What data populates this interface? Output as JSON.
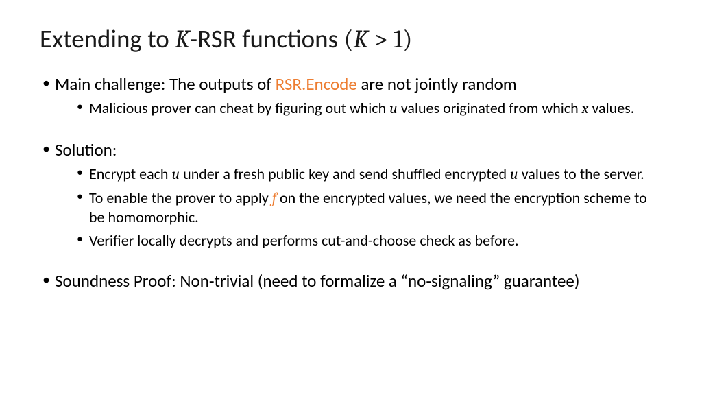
{
  "title": {
    "pre": "Extending to ",
    "k1": "K",
    "mid": "-RSR functions ",
    "paren_open": "(",
    "k2": "K",
    "gt": " > ",
    "one": "1",
    "paren_close": ")"
  },
  "bullets": {
    "b1": {
      "pre": "Main challenge: The outputs of ",
      "accent": "RSR.Encode",
      "post": " are not jointly random"
    },
    "b1s1": {
      "pre": "Malicious prover can cheat by figuring out which ",
      "u": "u",
      "mid": " values originated from which ",
      "x": "x",
      "post": " values."
    },
    "b2": "Solution:",
    "b2s1": {
      "pre": "Encrypt each ",
      "u1": "u",
      "mid": " under a fresh public key and send shuffled encrypted ",
      "u2": "u",
      "post": " values to the server."
    },
    "b2s2": {
      "pre": "To enable the prover to apply ",
      "f": "f",
      "post": " on the encrypted values, we need the encryption scheme to be homomorphic."
    },
    "b2s3": "Verifier locally decrypts and performs cut-and-choose check as before.",
    "b3": "Soundness Proof: Non-trivial (need to formalize a “no-signaling” guarantee)"
  }
}
